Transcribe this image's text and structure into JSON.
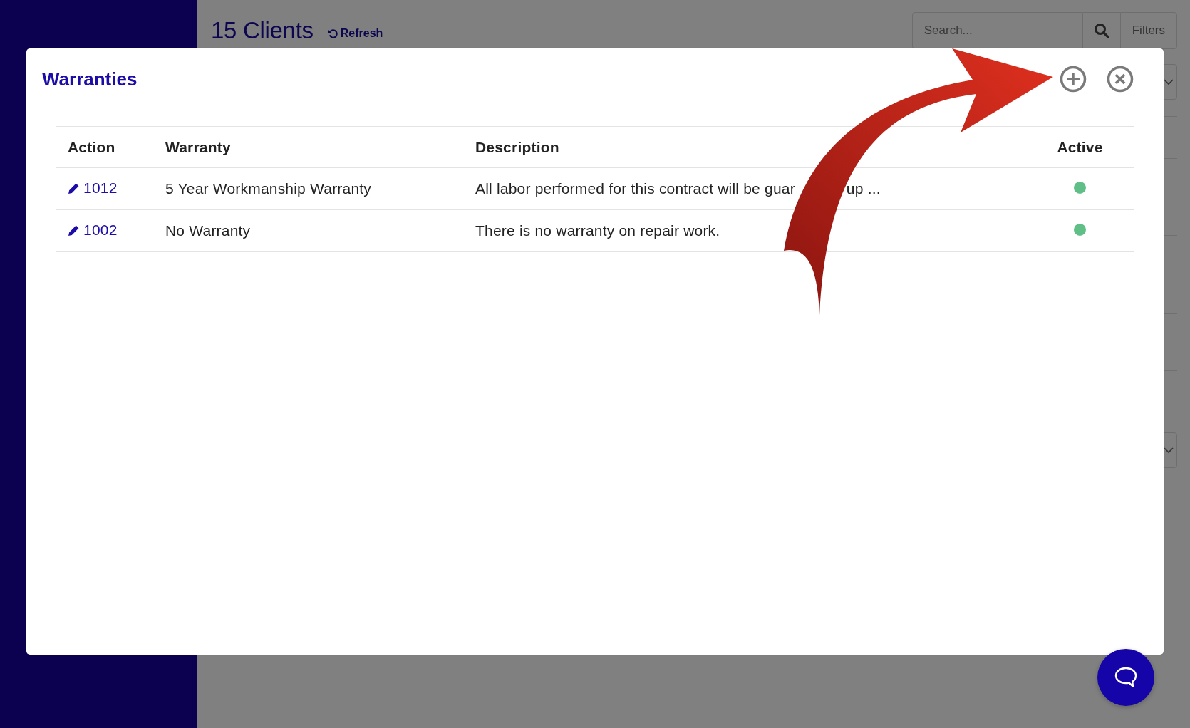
{
  "page": {
    "title": "15 Clients",
    "refresh": "Refresh",
    "search": {
      "placeholder": "Search..."
    },
    "filters": "Filters"
  },
  "modal": {
    "title": "Warranties",
    "columns": [
      "Action",
      "Warranty",
      "Description",
      "Active"
    ],
    "rows": [
      {
        "id": "1012",
        "warranty": "5 Year Workmanship Warranty",
        "description": "All labor performed for this contract will be guar",
        "description_tail": "up ...",
        "active": true
      },
      {
        "id": "1002",
        "warranty": "No Warranty",
        "description": "There is no warranty on repair work.",
        "active": true
      }
    ]
  }
}
